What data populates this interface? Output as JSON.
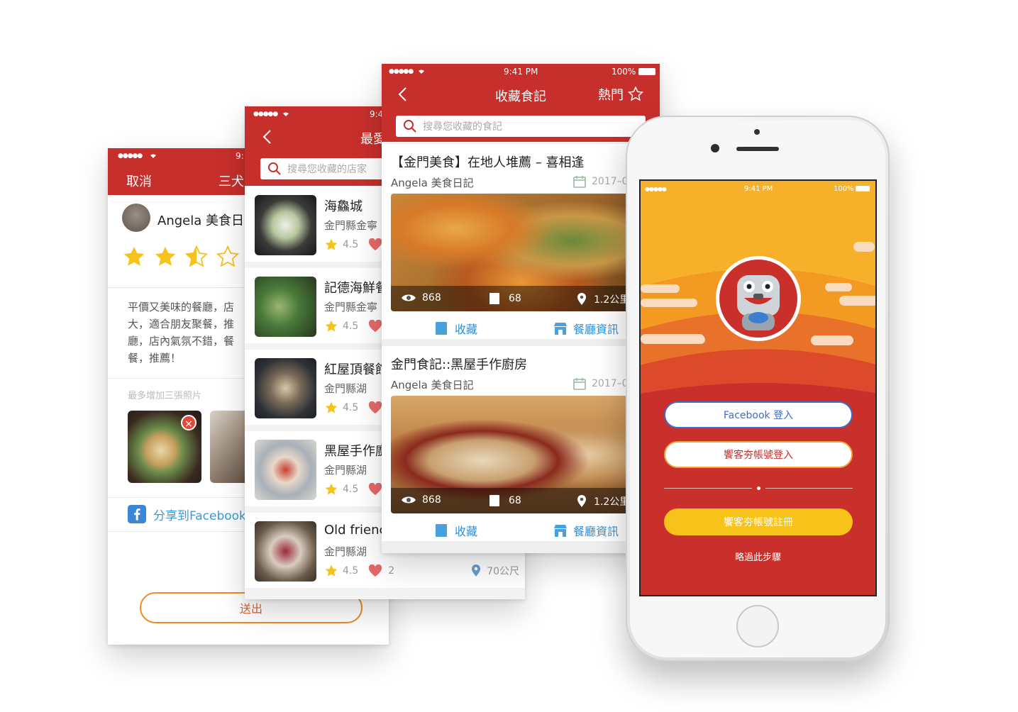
{
  "review_screen": {
    "status_carrier": "●●●●●",
    "status_time": "9:",
    "cancel_label": "取消",
    "nav_title": "三犬",
    "user_name": "Angela 美食日",
    "review_text": [
      "平價又美味的餐廳，店",
      "大，適合朋友聚餐，推",
      "廳，店內氣氛不錯，餐",
      "餐，推薦！"
    ],
    "photo_hint": "最多增加三張照片",
    "share_label": "分享到Facebook",
    "submit_label": "送出",
    "rating": 2.5
  },
  "list_screen": {
    "status_carrier": "●●●●●",
    "status_time": "9:4",
    "nav_title": "最愛",
    "search_placeholder": "搜尋您收藏的店家",
    "restaurants": [
      {
        "name": "海鱻城",
        "address": "金門縣金寧",
        "rating": "4.5"
      },
      {
        "name": "記德海鮮餐",
        "address": "金門縣金寧",
        "rating": "4.5"
      },
      {
        "name": "紅屋頂餐館",
        "address": "金門縣湖",
        "rating": "4.5"
      },
      {
        "name": "黑屋手作廚",
        "address": "金門縣湖",
        "rating": "4.5"
      },
      {
        "name": "Old frienc",
        "address": "金門縣湖",
        "rating": "4.5",
        "likes": "2",
        "distance": "70公尺"
      }
    ]
  },
  "articles_screen": {
    "status_carrier": "●●●●●",
    "status_time": "9:41 PM",
    "status_battery": "100%",
    "nav_title": "收藏食記",
    "hot_label": "熱門",
    "search_placeholder": "搜尋您收藏的食記",
    "articles": [
      {
        "title": "【金門美食】在地人堆薦 – 喜相逢",
        "author": "Angela 美食日記",
        "date": "2017–0",
        "views": "868",
        "saves": "68",
        "distance": "1.2公里"
      },
      {
        "title": "金門食記::黑屋手作廚房",
        "author": "Angela 美食日記",
        "date": "2017–0",
        "views": "868",
        "saves": "68",
        "distance": "1.2公里"
      }
    ],
    "collect_label": "收藏",
    "info_label": "餐廳資訊"
  },
  "login_screen": {
    "status_carrier": "●●●●●",
    "status_time": "9:41 PM",
    "status_battery": "100%",
    "facebook_login": "Facebook 登入",
    "account_login": "饗客夯帳號登入",
    "register": "饗客夯帳號註冊",
    "skip": "略過此步驟"
  },
  "colors": {
    "brand_red": "#c62f2b",
    "link_blue": "#2f8ed6",
    "star_yellow": "#f7c31a",
    "orange": "#f5a623"
  }
}
